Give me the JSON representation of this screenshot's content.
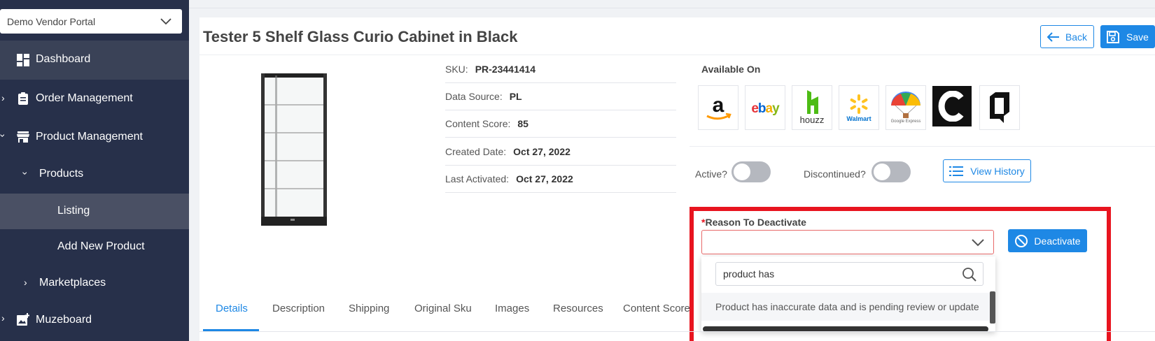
{
  "sidebar": {
    "portal": "Demo Vendor Portal",
    "items": [
      {
        "label": "Dashboard"
      },
      {
        "label": "Order Management"
      },
      {
        "label": "Product Management"
      },
      {
        "label": "Products"
      },
      {
        "label": "Listing"
      },
      {
        "label": "Add New Product"
      },
      {
        "label": "Marketplaces"
      },
      {
        "label": "Muzeboard"
      }
    ]
  },
  "header": {
    "title": "Tester 5 Shelf Glass Curio Cabinet in Black",
    "back_label": "Back",
    "save_label": "Save"
  },
  "product": {
    "sku_label": "SKU:",
    "sku": "PR-23441414",
    "source_label": "Data Source:",
    "source": "PL",
    "score_label": "Content Score:",
    "score": "85",
    "created_label": "Created Date:",
    "created": "Oct 27, 2022",
    "activated_label": "Last Activated:",
    "activated": "Oct 27, 2022"
  },
  "available": {
    "label": "Available On",
    "marketplaces": [
      "amazon-icon",
      "ebay-icon",
      "houzz-icon",
      "walmart-icon",
      "google-express-icon",
      "c-icon",
      "q-icon"
    ],
    "ebay": "ebay",
    "houzz": "houzz",
    "walmart": "Walmart",
    "google": "Google Express"
  },
  "status": {
    "active_label": "Active?",
    "discontinued_label": "Discontinued?",
    "history_label": "View History"
  },
  "deactivate": {
    "required_mark": "*",
    "label": "Reason To Deactivate",
    "button": "Deactivate",
    "search_value": "product has",
    "option": "Product has inaccurate data and is pending review or update"
  },
  "tabs": [
    "Details",
    "Description",
    "Shipping",
    "Original Sku",
    "Images",
    "Resources",
    "Content Score"
  ],
  "colors": {
    "accent": "#1e88e5",
    "sidebar": "#27304a",
    "highlight": "#e8141f"
  }
}
